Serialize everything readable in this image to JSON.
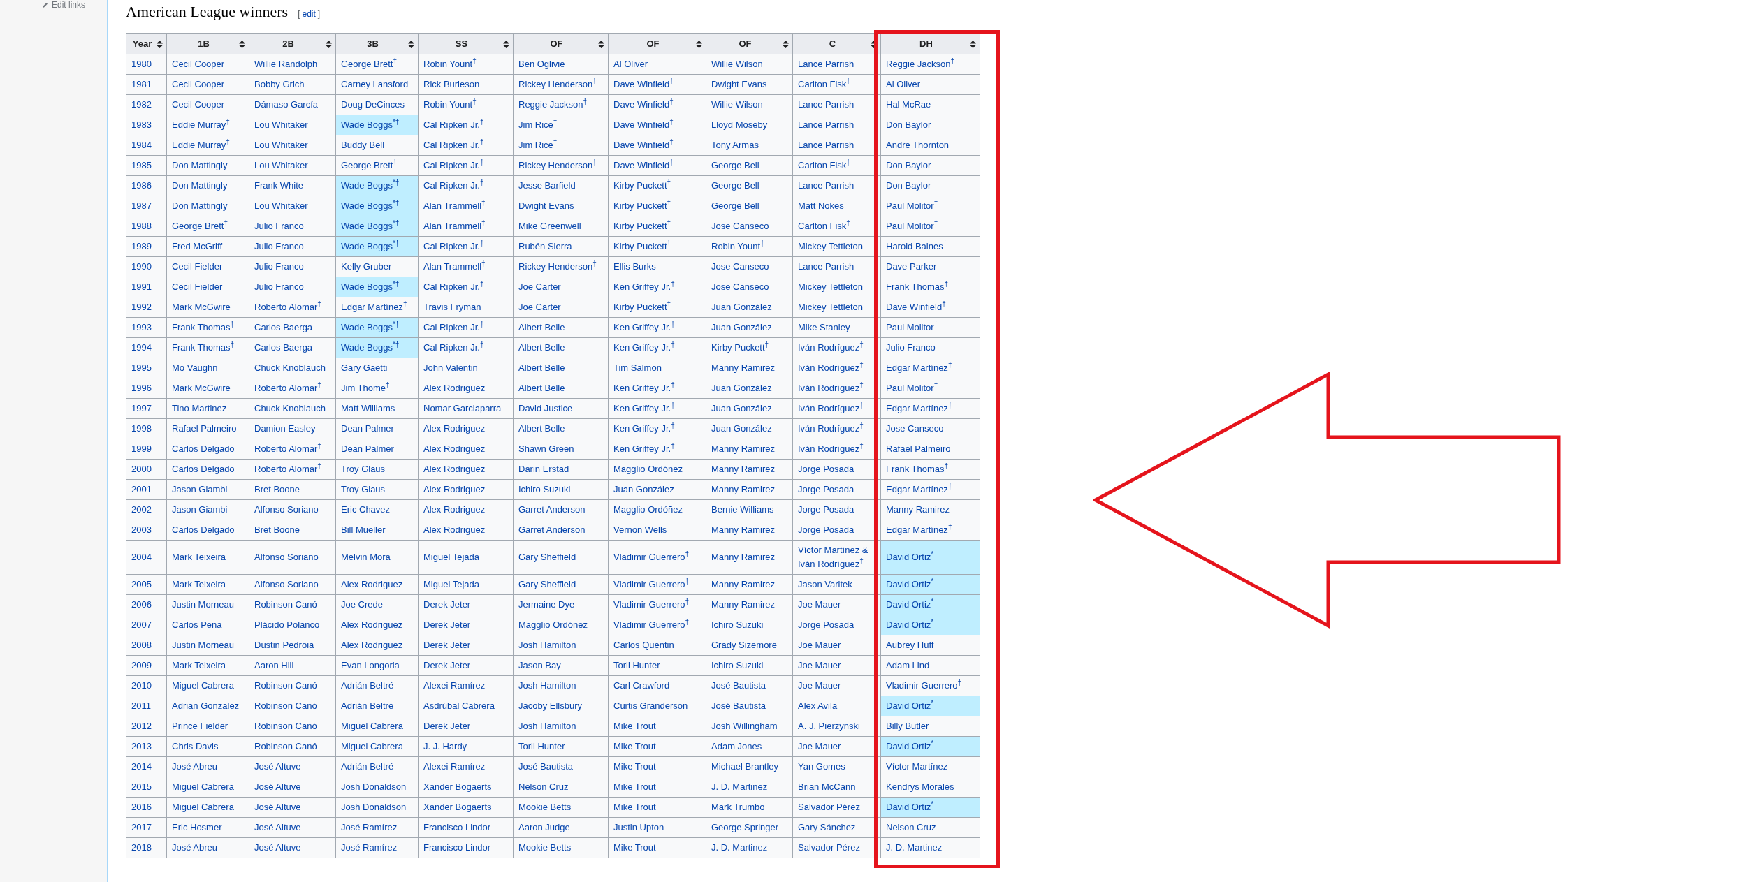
{
  "sidebar": {
    "link": "Edit links"
  },
  "section": {
    "title": "American League winners",
    "edit_open": "[",
    "edit_label": "edit",
    "edit_close": "]"
  },
  "table": {
    "columns": [
      {
        "label": "Year"
      },
      {
        "label": "1B"
      },
      {
        "label": "2B"
      },
      {
        "label": "3B"
      },
      {
        "label": "SS"
      },
      {
        "label": "OF"
      },
      {
        "label": "OF"
      },
      {
        "label": "OF"
      },
      {
        "label": "C"
      },
      {
        "label": "DH"
      }
    ],
    "rows": [
      {
        "cells": [
          {
            "text": "1980",
            "highlighted": false
          },
          {
            "text": "Cecil Cooper",
            "highlighted": false
          },
          {
            "text": "Willie Randolph",
            "highlighted": false
          },
          {
            "text": "George Brett$^{†}$",
            "highlighted": false
          },
          {
            "text": "Robin Yount$^{†}$",
            "highlighted": false
          },
          {
            "text": "Ben Oglivie",
            "highlighted": false
          },
          {
            "text": "Al Oliver",
            "highlighted": false
          },
          {
            "text": "Willie Wilson",
            "highlighted": false
          },
          {
            "text": "Lance Parrish",
            "highlighted": false
          },
          {
            "text": "Reggie Jackson$^{†}$",
            "highlighted": false
          }
        ]
      },
      {
        "cells": [
          {
            "text": "1981",
            "highlighted": false
          },
          {
            "text": "Cecil Cooper",
            "highlighted": false
          },
          {
            "text": "Bobby Grich",
            "highlighted": false
          },
          {
            "text": "Carney Lansford",
            "highlighted": false
          },
          {
            "text": "Rick Burleson",
            "highlighted": false
          },
          {
            "text": "Rickey Henderson$^{†}$",
            "highlighted": false
          },
          {
            "text": "Dave Winfield$^{†}$",
            "highlighted": false
          },
          {
            "text": "Dwight Evans",
            "highlighted": false
          },
          {
            "text": "Carlton Fisk$^{†}$",
            "highlighted": false
          },
          {
            "text": "Al Oliver",
            "highlighted": false
          }
        ]
      },
      {
        "cells": [
          {
            "text": "1982",
            "highlighted": false
          },
          {
            "text": "Cecil Cooper",
            "highlighted": false
          },
          {
            "text": "Dámaso García",
            "highlighted": false
          },
          {
            "text": "Doug DeCinces",
            "highlighted": false
          },
          {
            "text": "Robin Yount$^{†}$",
            "highlighted": false
          },
          {
            "text": "Reggie Jackson$^{†}$",
            "highlighted": false
          },
          {
            "text": "Dave Winfield$^{†}$",
            "highlighted": false
          },
          {
            "text": "Willie Wilson",
            "highlighted": false
          },
          {
            "text": "Lance Parrish",
            "highlighted": false
          },
          {
            "text": "Hal McRae",
            "highlighted": false
          }
        ]
      },
      {
        "cells": [
          {
            "text": "1983",
            "highlighted": false
          },
          {
            "text": "Eddie Murray$^{†}$",
            "highlighted": false
          },
          {
            "text": "Lou Whitaker",
            "highlighted": false
          },
          {
            "text": "Wade Boggs$^{*†}$",
            "highlighted": true
          },
          {
            "text": "Cal Ripken Jr.$^{†}$",
            "highlighted": false
          },
          {
            "text": "Jim Rice$^{†}$",
            "highlighted": false
          },
          {
            "text": "Dave Winfield$^{†}$",
            "highlighted": false
          },
          {
            "text": "Lloyd Moseby",
            "highlighted": false
          },
          {
            "text": "Lance Parrish",
            "highlighted": false
          },
          {
            "text": "Don Baylor",
            "highlighted": false
          }
        ]
      },
      {
        "cells": [
          {
            "text": "1984",
            "highlighted": false
          },
          {
            "text": "Eddie Murray$^{†}$",
            "highlighted": false
          },
          {
            "text": "Lou Whitaker",
            "highlighted": false
          },
          {
            "text": "Buddy Bell",
            "highlighted": false
          },
          {
            "text": "Cal Ripken Jr.$^{†}$",
            "highlighted": false
          },
          {
            "text": "Jim Rice$^{†}$",
            "highlighted": false
          },
          {
            "text": "Dave Winfield$^{†}$",
            "highlighted": false
          },
          {
            "text": "Tony Armas",
            "highlighted": false
          },
          {
            "text": "Lance Parrish",
            "highlighted": false
          },
          {
            "text": "Andre Thornton",
            "highlighted": false
          }
        ]
      },
      {
        "cells": [
          {
            "text": "1985",
            "highlighted": false
          },
          {
            "text": "Don Mattingly",
            "highlighted": false
          },
          {
            "text": "Lou Whitaker",
            "highlighted": false
          },
          {
            "text": "George Brett$^{†}$",
            "highlighted": false
          },
          {
            "text": "Cal Ripken Jr.$^{†}$",
            "highlighted": false
          },
          {
            "text": "Rickey Henderson$^{†}$",
            "highlighted": false
          },
          {
            "text": "Dave Winfield$^{†}$",
            "highlighted": false
          },
          {
            "text": "George Bell",
            "highlighted": false
          },
          {
            "text": "Carlton Fisk$^{†}$",
            "highlighted": false
          },
          {
            "text": "Don Baylor",
            "highlighted": false
          }
        ]
      },
      {
        "cells": [
          {
            "text": "1986",
            "highlighted": false
          },
          {
            "text": "Don Mattingly",
            "highlighted": false
          },
          {
            "text": "Frank White",
            "highlighted": false
          },
          {
            "text": "Wade Boggs$^{*†}$",
            "highlighted": true
          },
          {
            "text": "Cal Ripken Jr.$^{†}$",
            "highlighted": false
          },
          {
            "text": "Jesse Barfield",
            "highlighted": false
          },
          {
            "text": "Kirby Puckett$^{†}$",
            "highlighted": false
          },
          {
            "text": "George Bell",
            "highlighted": false
          },
          {
            "text": "Lance Parrish",
            "highlighted": false
          },
          {
            "text": "Don Baylor",
            "highlighted": false
          }
        ]
      },
      {
        "cells": [
          {
            "text": "1987",
            "highlighted": false
          },
          {
            "text": "Don Mattingly",
            "highlighted": false
          },
          {
            "text": "Lou Whitaker",
            "highlighted": false
          },
          {
            "text": "Wade Boggs$^{*†}$",
            "highlighted": true
          },
          {
            "text": "Alan Trammell$^{†}$",
            "highlighted": false
          },
          {
            "text": "Dwight Evans",
            "highlighted": false
          },
          {
            "text": "Kirby Puckett$^{†}$",
            "highlighted": false
          },
          {
            "text": "George Bell",
            "highlighted": false
          },
          {
            "text": "Matt Nokes",
            "highlighted": false
          },
          {
            "text": "Paul Molitor$^{†}$",
            "highlighted": false
          }
        ]
      },
      {
        "cells": [
          {
            "text": "1988",
            "highlighted": false
          },
          {
            "text": "George Brett$^{†}$",
            "highlighted": false
          },
          {
            "text": "Julio Franco",
            "highlighted": false
          },
          {
            "text": "Wade Boggs$^{*†}$",
            "highlighted": true
          },
          {
            "text": "Alan Trammell$^{†}$",
            "highlighted": false
          },
          {
            "text": "Mike Greenwell",
            "highlighted": false
          },
          {
            "text": "Kirby Puckett$^{†}$",
            "highlighted": false
          },
          {
            "text": "Jose Canseco",
            "highlighted": false
          },
          {
            "text": "Carlton Fisk$^{†}$",
            "highlighted": false
          },
          {
            "text": "Paul Molitor$^{†}$",
            "highlighted": false
          }
        ]
      },
      {
        "cells": [
          {
            "text": "1989",
            "highlighted": false
          },
          {
            "text": "Fred McGriff",
            "highlighted": false
          },
          {
            "text": "Julio Franco",
            "highlighted": false
          },
          {
            "text": "Wade Boggs$^{*†}$",
            "highlighted": true
          },
          {
            "text": "Cal Ripken Jr.$^{†}$",
            "highlighted": false
          },
          {
            "text": "Rubén Sierra",
            "highlighted": false
          },
          {
            "text": "Kirby Puckett$^{†}$",
            "highlighted": false
          },
          {
            "text": "Robin Yount$^{†}$",
            "highlighted": false
          },
          {
            "text": "Mickey Tettleton",
            "highlighted": false
          },
          {
            "text": "Harold Baines$^{†}$",
            "highlighted": false
          }
        ]
      },
      {
        "cells": [
          {
            "text": "1990",
            "highlighted": false
          },
          {
            "text": "Cecil Fielder",
            "highlighted": false
          },
          {
            "text": "Julio Franco",
            "highlighted": false
          },
          {
            "text": "Kelly Gruber",
            "highlighted": false
          },
          {
            "text": "Alan Trammell$^{†}$",
            "highlighted": false
          },
          {
            "text": "Rickey Henderson$^{†}$",
            "highlighted": false
          },
          {
            "text": "Ellis Burks",
            "highlighted": false
          },
          {
            "text": "Jose Canseco",
            "highlighted": false
          },
          {
            "text": "Lance Parrish",
            "highlighted": false
          },
          {
            "text": "Dave Parker",
            "highlighted": false
          }
        ]
      },
      {
        "cells": [
          {
            "text": "1991",
            "highlighted": false
          },
          {
            "text": "Cecil Fielder",
            "highlighted": false
          },
          {
            "text": "Julio Franco",
            "highlighted": false
          },
          {
            "text": "Wade Boggs$^{*†}$",
            "highlighted": true
          },
          {
            "text": "Cal Ripken Jr.$^{†}$",
            "highlighted": false
          },
          {
            "text": "Joe Carter",
            "highlighted": false
          },
          {
            "text": "Ken Griffey Jr.$^{†}$",
            "highlighted": false
          },
          {
            "text": "Jose Canseco",
            "highlighted": false
          },
          {
            "text": "Mickey Tettleton",
            "highlighted": false
          },
          {
            "text": "Frank Thomas$^{†}$",
            "highlighted": false
          }
        ]
      },
      {
        "cells": [
          {
            "text": "1992",
            "highlighted": false
          },
          {
            "text": "Mark McGwire",
            "highlighted": false
          },
          {
            "text": "Roberto Alomar$^{†}$",
            "highlighted": false
          },
          {
            "text": "Edgar Martínez$^{†}$",
            "highlighted": false
          },
          {
            "text": "Travis Fryman",
            "highlighted": false
          },
          {
            "text": "Joe Carter",
            "highlighted": false
          },
          {
            "text": "Kirby Puckett$^{†}$",
            "highlighted": false
          },
          {
            "text": "Juan González",
            "highlighted": false
          },
          {
            "text": "Mickey Tettleton",
            "highlighted": false
          },
          {
            "text": "Dave Winfield$^{†}$",
            "highlighted": false
          }
        ]
      },
      {
        "cells": [
          {
            "text": "1993",
            "highlighted": false
          },
          {
            "text": "Frank Thomas$^{†}$",
            "highlighted": false
          },
          {
            "text": "Carlos Baerga",
            "highlighted": false
          },
          {
            "text": "Wade Boggs$^{*†}$",
            "highlighted": true
          },
          {
            "text": "Cal Ripken Jr.$^{†}$",
            "highlighted": false
          },
          {
            "text": "Albert Belle",
            "highlighted": false
          },
          {
            "text": "Ken Griffey Jr.$^{†}$",
            "highlighted": false
          },
          {
            "text": "Juan González",
            "highlighted": false
          },
          {
            "text": "Mike Stanley",
            "highlighted": false
          },
          {
            "text": "Paul Molitor$^{†}$",
            "highlighted": false
          }
        ]
      },
      {
        "cells": [
          {
            "text": "1994",
            "highlighted": false
          },
          {
            "text": "Frank Thomas$^{†}$",
            "highlighted": false
          },
          {
            "text": "Carlos Baerga",
            "highlighted": false
          },
          {
            "text": "Wade Boggs$^{*†}$",
            "highlighted": true
          },
          {
            "text": "Cal Ripken Jr.$^{†}$",
            "highlighted": false
          },
          {
            "text": "Albert Belle",
            "highlighted": false
          },
          {
            "text": "Ken Griffey Jr.$^{†}$",
            "highlighted": false
          },
          {
            "text": "Kirby Puckett$^{†}$",
            "highlighted": false
          },
          {
            "text": "Iván Rodríguez$^{†}$",
            "highlighted": false
          },
          {
            "text": "Julio Franco",
            "highlighted": false
          }
        ]
      },
      {
        "cells": [
          {
            "text": "1995",
            "highlighted": false
          },
          {
            "text": "Mo Vaughn",
            "highlighted": false
          },
          {
            "text": "Chuck Knoblauch",
            "highlighted": false
          },
          {
            "text": "Gary Gaetti",
            "highlighted": false
          },
          {
            "text": "John Valentin",
            "highlighted": false
          },
          {
            "text": "Albert Belle",
            "highlighted": false
          },
          {
            "text": "Tim Salmon",
            "highlighted": false
          },
          {
            "text": "Manny Ramirez",
            "highlighted": false
          },
          {
            "text": "Iván Rodríguez$^{†}$",
            "highlighted": false
          },
          {
            "text": "Edgar Martínez$^{†}$",
            "highlighted": false
          }
        ]
      },
      {
        "cells": [
          {
            "text": "1996",
            "highlighted": false
          },
          {
            "text": "Mark McGwire",
            "highlighted": false
          },
          {
            "text": "Roberto Alomar$^{†}$",
            "highlighted": false
          },
          {
            "text": "Jim Thome$^{†}$",
            "highlighted": false
          },
          {
            "text": "Alex Rodriguez",
            "highlighted": false
          },
          {
            "text": "Albert Belle",
            "highlighted": false
          },
          {
            "text": "Ken Griffey Jr.$^{†}$",
            "highlighted": false
          },
          {
            "text": "Juan González",
            "highlighted": false
          },
          {
            "text": "Iván Rodríguez$^{†}$",
            "highlighted": false
          },
          {
            "text": "Paul Molitor$^{†}$",
            "highlighted": false
          }
        ]
      },
      {
        "cells": [
          {
            "text": "1997",
            "highlighted": false
          },
          {
            "text": "Tino Martinez",
            "highlighted": false
          },
          {
            "text": "Chuck Knoblauch",
            "highlighted": false
          },
          {
            "text": "Matt Williams",
            "highlighted": false
          },
          {
            "text": "Nomar Garciaparra",
            "highlighted": false
          },
          {
            "text": "David Justice",
            "highlighted": false
          },
          {
            "text": "Ken Griffey Jr.$^{†}$",
            "highlighted": false
          },
          {
            "text": "Juan González",
            "highlighted": false
          },
          {
            "text": "Iván Rodríguez$^{†}$",
            "highlighted": false
          },
          {
            "text": "Edgar Martínez$^{†}$",
            "highlighted": false
          }
        ]
      },
      {
        "cells": [
          {
            "text": "1998",
            "highlighted": false
          },
          {
            "text": "Rafael Palmeiro",
            "highlighted": false
          },
          {
            "text": "Damion Easley",
            "highlighted": false
          },
          {
            "text": "Dean Palmer",
            "highlighted": false
          },
          {
            "text": "Alex Rodriguez",
            "highlighted": false
          },
          {
            "text": "Albert Belle",
            "highlighted": false
          },
          {
            "text": "Ken Griffey Jr.$^{†}$",
            "highlighted": false
          },
          {
            "text": "Juan González",
            "highlighted": false
          },
          {
            "text": "Iván Rodríguez$^{†}$",
            "highlighted": false
          },
          {
            "text": "Jose Canseco",
            "highlighted": false
          }
        ]
      },
      {
        "cells": [
          {
            "text": "1999",
            "highlighted": false
          },
          {
            "text": "Carlos Delgado",
            "highlighted": false
          },
          {
            "text": "Roberto Alomar$^{†}$",
            "highlighted": false
          },
          {
            "text": "Dean Palmer",
            "highlighted": false
          },
          {
            "text": "Alex Rodriguez",
            "highlighted": false
          },
          {
            "text": "Shawn Green",
            "highlighted": false
          },
          {
            "text": "Ken Griffey Jr.$^{†}$",
            "highlighted": false
          },
          {
            "text": "Manny Ramirez",
            "highlighted": false
          },
          {
            "text": "Iván Rodríguez$^{†}$",
            "highlighted": false
          },
          {
            "text": "Rafael Palmeiro",
            "highlighted": false
          }
        ]
      },
      {
        "cells": [
          {
            "text": "2000",
            "highlighted": false
          },
          {
            "text": "Carlos Delgado",
            "highlighted": false
          },
          {
            "text": "Roberto Alomar$^{†}$",
            "highlighted": false
          },
          {
            "text": "Troy Glaus",
            "highlighted": false
          },
          {
            "text": "Alex Rodriguez",
            "highlighted": false
          },
          {
            "text": "Darin Erstad",
            "highlighted": false
          },
          {
            "text": "Magglio Ordóñez",
            "highlighted": false
          },
          {
            "text": "Manny Ramirez",
            "highlighted": false
          },
          {
            "text": "Jorge Posada",
            "highlighted": false
          },
          {
            "text": "Frank Thomas$^{†}$",
            "highlighted": false
          }
        ]
      },
      {
        "cells": [
          {
            "text": "2001",
            "highlighted": false
          },
          {
            "text": "Jason Giambi",
            "highlighted": false
          },
          {
            "text": "Bret Boone",
            "highlighted": false
          },
          {
            "text": "Troy Glaus",
            "highlighted": false
          },
          {
            "text": "Alex Rodriguez",
            "highlighted": false
          },
          {
            "text": "Ichiro Suzuki",
            "highlighted": false
          },
          {
            "text": "Juan González",
            "highlighted": false
          },
          {
            "text": "Manny Ramirez",
            "highlighted": false
          },
          {
            "text": "Jorge Posada",
            "highlighted": false
          },
          {
            "text": "Edgar Martínez$^{†}$",
            "highlighted": false
          }
        ]
      },
      {
        "cells": [
          {
            "text": "2002",
            "highlighted": false
          },
          {
            "text": "Jason Giambi",
            "highlighted": false
          },
          {
            "text": "Alfonso Soriano",
            "highlighted": false
          },
          {
            "text": "Eric Chavez",
            "highlighted": false
          },
          {
            "text": "Alex Rodriguez",
            "highlighted": false
          },
          {
            "text": "Garret Anderson",
            "highlighted": false
          },
          {
            "text": "Magglio Ordóñez",
            "highlighted": false
          },
          {
            "text": "Bernie Williams",
            "highlighted": false
          },
          {
            "text": "Jorge Posada",
            "highlighted": false
          },
          {
            "text": "Manny Ramirez",
            "highlighted": false
          }
        ]
      },
      {
        "cells": [
          {
            "text": "2003",
            "highlighted": false
          },
          {
            "text": "Carlos Delgado",
            "highlighted": false
          },
          {
            "text": "Bret Boone",
            "highlighted": false
          },
          {
            "text": "Bill Mueller",
            "highlighted": false
          },
          {
            "text": "Alex Rodriguez",
            "highlighted": false
          },
          {
            "text": "Garret Anderson",
            "highlighted": false
          },
          {
            "text": "Vernon Wells",
            "highlighted": false
          },
          {
            "text": "Manny Ramirez",
            "highlighted": false
          },
          {
            "text": "Jorge Posada",
            "highlighted": false
          },
          {
            "text": "Edgar Martínez$^{†}$",
            "highlighted": false
          }
        ]
      },
      {
        "cells": [
          {
            "text": "2004",
            "highlighted": false
          },
          {
            "text": "Mark Teixeira",
            "highlighted": false
          },
          {
            "text": "Alfonso Soriano",
            "highlighted": false
          },
          {
            "text": "Melvin Mora",
            "highlighted": false
          },
          {
            "text": "Miguel Tejada",
            "highlighted": false
          },
          {
            "text": "Gary Sheffield",
            "highlighted": false
          },
          {
            "text": "Vladimir Guerrero$^{†}$",
            "highlighted": false
          },
          {
            "text": "Manny Ramirez",
            "highlighted": false
          },
          {
            "text": "Víctor Martínez & Iván Rodríguez$^{†}$",
            "highlighted": false
          },
          {
            "text": "David Ortiz$^{*}$",
            "highlighted": true
          }
        ]
      },
      {
        "cells": [
          {
            "text": "2005",
            "highlighted": false
          },
          {
            "text": "Mark Teixeira",
            "highlighted": false
          },
          {
            "text": "Alfonso Soriano",
            "highlighted": false
          },
          {
            "text": "Alex Rodriguez",
            "highlighted": false
          },
          {
            "text": "Miguel Tejada",
            "highlighted": false
          },
          {
            "text": "Gary Sheffield",
            "highlighted": false
          },
          {
            "text": "Vladimir Guerrero$^{†}$",
            "highlighted": false
          },
          {
            "text": "Manny Ramirez",
            "highlighted": false
          },
          {
            "text": "Jason Varitek",
            "highlighted": false
          },
          {
            "text": "David Ortiz$^{*}$",
            "highlighted": true
          }
        ]
      },
      {
        "cells": [
          {
            "text": "2006",
            "highlighted": false
          },
          {
            "text": "Justin Morneau",
            "highlighted": false
          },
          {
            "text": "Robinson Canó",
            "highlighted": false
          },
          {
            "text": "Joe Crede",
            "highlighted": false
          },
          {
            "text": "Derek Jeter",
            "highlighted": false
          },
          {
            "text": "Jermaine Dye",
            "highlighted": false
          },
          {
            "text": "Vladimir Guerrero$^{†}$",
            "highlighted": false
          },
          {
            "text": "Manny Ramirez",
            "highlighted": false
          },
          {
            "text": "Joe Mauer",
            "highlighted": false
          },
          {
            "text": "David Ortiz$^{*}$",
            "highlighted": true
          }
        ]
      },
      {
        "cells": [
          {
            "text": "2007",
            "highlighted": false
          },
          {
            "text": "Carlos Peña",
            "highlighted": false
          },
          {
            "text": "Plácido Polanco",
            "highlighted": false
          },
          {
            "text": "Alex Rodriguez",
            "highlighted": false
          },
          {
            "text": "Derek Jeter",
            "highlighted": false
          },
          {
            "text": "Magglio Ordóñez",
            "highlighted": false
          },
          {
            "text": "Vladimir Guerrero$^{†}$",
            "highlighted": false
          },
          {
            "text": "Ichiro Suzuki",
            "highlighted": false
          },
          {
            "text": "Jorge Posada",
            "highlighted": false
          },
          {
            "text": "David Ortiz$^{*}$",
            "highlighted": true
          }
        ]
      },
      {
        "cells": [
          {
            "text": "2008",
            "highlighted": false
          },
          {
            "text": "Justin Morneau",
            "highlighted": false
          },
          {
            "text": "Dustin Pedroia",
            "highlighted": false
          },
          {
            "text": "Alex Rodriguez",
            "highlighted": false
          },
          {
            "text": "Derek Jeter",
            "highlighted": false
          },
          {
            "text": "Josh Hamilton",
            "highlighted": false
          },
          {
            "text": "Carlos Quentin",
            "highlighted": false
          },
          {
            "text": "Grady Sizemore",
            "highlighted": false
          },
          {
            "text": "Joe Mauer",
            "highlighted": false
          },
          {
            "text": "Aubrey Huff",
            "highlighted": false
          }
        ]
      },
      {
        "cells": [
          {
            "text": "2009",
            "highlighted": false
          },
          {
            "text": "Mark Teixeira",
            "highlighted": false
          },
          {
            "text": "Aaron Hill",
            "highlighted": false
          },
          {
            "text": "Evan Longoria",
            "highlighted": false
          },
          {
            "text": "Derek Jeter",
            "highlighted": false
          },
          {
            "text": "Jason Bay",
            "highlighted": false
          },
          {
            "text": "Torii Hunter",
            "highlighted": false
          },
          {
            "text": "Ichiro Suzuki",
            "highlighted": false
          },
          {
            "text": "Joe Mauer",
            "highlighted": false
          },
          {
            "text": "Adam Lind",
            "highlighted": false
          }
        ]
      },
      {
        "cells": [
          {
            "text": "2010",
            "highlighted": false
          },
          {
            "text": "Miguel Cabrera",
            "highlighted": false
          },
          {
            "text": "Robinson Canó",
            "highlighted": false
          },
          {
            "text": "Adrián Beltré",
            "highlighted": false
          },
          {
            "text": "Alexei Ramírez",
            "highlighted": false
          },
          {
            "text": "Josh Hamilton",
            "highlighted": false
          },
          {
            "text": "Carl Crawford",
            "highlighted": false
          },
          {
            "text": "José Bautista",
            "highlighted": false
          },
          {
            "text": "Joe Mauer",
            "highlighted": false
          },
          {
            "text": "Vladimir Guerrero$^{†}$",
            "highlighted": false
          }
        ]
      },
      {
        "cells": [
          {
            "text": "2011",
            "highlighted": false
          },
          {
            "text": "Adrian Gonzalez",
            "highlighted": false
          },
          {
            "text": "Robinson Canó",
            "highlighted": false
          },
          {
            "text": "Adrián Beltré",
            "highlighted": false
          },
          {
            "text": "Asdrúbal Cabrera",
            "highlighted": false
          },
          {
            "text": "Jacoby Ellsbury",
            "highlighted": false
          },
          {
            "text": "Curtis Granderson",
            "highlighted": false
          },
          {
            "text": "José Bautista",
            "highlighted": false
          },
          {
            "text": "Alex Avila",
            "highlighted": false
          },
          {
            "text": "David Ortiz$^{*}$",
            "highlighted": true
          }
        ]
      },
      {
        "cells": [
          {
            "text": "2012",
            "highlighted": false
          },
          {
            "text": "Prince Fielder",
            "highlighted": false
          },
          {
            "text": "Robinson Canó",
            "highlighted": false
          },
          {
            "text": "Miguel Cabrera",
            "highlighted": false
          },
          {
            "text": "Derek Jeter",
            "highlighted": false
          },
          {
            "text": "Josh Hamilton",
            "highlighted": false
          },
          {
            "text": "Mike Trout",
            "highlighted": false
          },
          {
            "text": "Josh Willingham",
            "highlighted": false
          },
          {
            "text": "A. J. Pierzynski",
            "highlighted": false
          },
          {
            "text": "Billy Butler",
            "highlighted": false
          }
        ]
      },
      {
        "cells": [
          {
            "text": "2013",
            "highlighted": false
          },
          {
            "text": "Chris Davis",
            "highlighted": false
          },
          {
            "text": "Robinson Canó",
            "highlighted": false
          },
          {
            "text": "Miguel Cabrera",
            "highlighted": false
          },
          {
            "text": "J. J. Hardy",
            "highlighted": false
          },
          {
            "text": "Torii Hunter",
            "highlighted": false
          },
          {
            "text": "Mike Trout",
            "highlighted": false
          },
          {
            "text": "Adam Jones",
            "highlighted": false
          },
          {
            "text": "Joe Mauer",
            "highlighted": false
          },
          {
            "text": "David Ortiz$^{*}$",
            "highlighted": true
          }
        ]
      },
      {
        "cells": [
          {
            "text": "2014",
            "highlighted": false
          },
          {
            "text": "José Abreu",
            "highlighted": false
          },
          {
            "text": "José Altuve",
            "highlighted": false
          },
          {
            "text": "Adrián Beltré",
            "highlighted": false
          },
          {
            "text": "Alexei Ramírez",
            "highlighted": false
          },
          {
            "text": "José Bautista",
            "highlighted": false
          },
          {
            "text": "Mike Trout",
            "highlighted": false
          },
          {
            "text": "Michael Brantley",
            "highlighted": false
          },
          {
            "text": "Yan Gomes",
            "highlighted": false
          },
          {
            "text": "Víctor Martínez",
            "highlighted": false
          }
        ]
      },
      {
        "cells": [
          {
            "text": "2015",
            "highlighted": false
          },
          {
            "text": "Miguel Cabrera",
            "highlighted": false
          },
          {
            "text": "José Altuve",
            "highlighted": false
          },
          {
            "text": "Josh Donaldson",
            "highlighted": false
          },
          {
            "text": "Xander Bogaerts",
            "highlighted": false
          },
          {
            "text": "Nelson Cruz",
            "highlighted": false
          },
          {
            "text": "Mike Trout",
            "highlighted": false
          },
          {
            "text": "J. D. Martinez",
            "highlighted": false
          },
          {
            "text": "Brian McCann",
            "highlighted": false
          },
          {
            "text": "Kendrys Morales",
            "highlighted": false
          }
        ]
      },
      {
        "cells": [
          {
            "text": "2016",
            "highlighted": false
          },
          {
            "text": "Miguel Cabrera",
            "highlighted": false
          },
          {
            "text": "José Altuve",
            "highlighted": false
          },
          {
            "text": "Josh Donaldson",
            "highlighted": false
          },
          {
            "text": "Xander Bogaerts",
            "highlighted": false
          },
          {
            "text": "Mookie Betts",
            "highlighted": false
          },
          {
            "text": "Mike Trout",
            "highlighted": false
          },
          {
            "text": "Mark Trumbo",
            "highlighted": false
          },
          {
            "text": "Salvador Pérez",
            "highlighted": false
          },
          {
            "text": "David Ortiz$^{*}$",
            "highlighted": true
          }
        ]
      },
      {
        "cells": [
          {
            "text": "2017",
            "highlighted": false
          },
          {
            "text": "Eric Hosmer",
            "highlighted": false
          },
          {
            "text": "José Altuve",
            "highlighted": false
          },
          {
            "text": "José Ramírez",
            "highlighted": false
          },
          {
            "text": "Francisco Lindor",
            "highlighted": false
          },
          {
            "text": "Aaron Judge",
            "highlighted": false
          },
          {
            "text": "Justin Upton",
            "highlighted": false
          },
          {
            "text": "George Springer",
            "highlighted": false
          },
          {
            "text": "Gary Sánchez",
            "highlighted": false
          },
          {
            "text": "Nelson Cruz",
            "highlighted": false
          }
        ]
      },
      {
        "cells": [
          {
            "text": "2018",
            "highlighted": false
          },
          {
            "text": "José Abreu",
            "highlighted": false
          },
          {
            "text": "José Altuve",
            "highlighted": false
          },
          {
            "text": "José Ramírez",
            "highlighted": false
          },
          {
            "text": "Francisco Lindor",
            "highlighted": false
          },
          {
            "text": "Mookie Betts",
            "highlighted": false
          },
          {
            "text": "Mike Trout",
            "highlighted": false
          },
          {
            "text": "J. D. Martinez",
            "highlighted": false
          },
          {
            "text": "Salvador Pérez",
            "highlighted": false
          },
          {
            "text": "J. D. Martinez",
            "highlighted": false
          }
        ]
      }
    ]
  }
}
